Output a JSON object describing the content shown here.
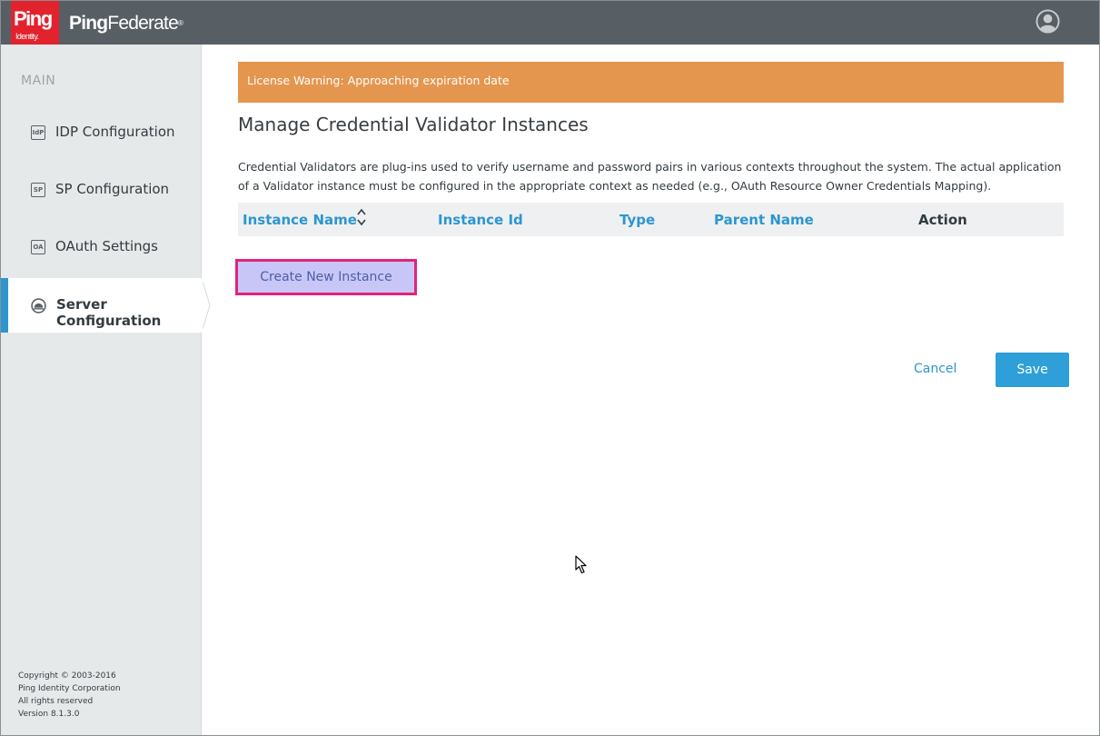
{
  "header": {
    "logo_text": "Ping",
    "logo_subtext": "Identity.",
    "product_part1": "Ping",
    "product_part2": "Federate",
    "trademark": "®"
  },
  "sidebar": {
    "section_label": "MAIN",
    "items": [
      {
        "label": "IDP Configuration",
        "icon": "IdP",
        "icon_name": "idp-icon"
      },
      {
        "label": "SP Configuration",
        "icon": "SP",
        "icon_name": "sp-icon"
      },
      {
        "label": "OAuth Settings",
        "icon": "OA",
        "icon_name": "oauth-icon"
      },
      {
        "label": "Server Configuration",
        "icon": "",
        "icon_name": "server-icon",
        "active": true
      }
    ],
    "copyright": [
      "Copyright © 2003-2016",
      "Ping Identity Corporation",
      "All rights reserved",
      "Version 8.1.3.0"
    ]
  },
  "main": {
    "banner": "License Warning: Approaching expiration date",
    "title": "Manage Credential Validator Instances",
    "description": "Credential Validators are plug-ins used to verify username and password pairs in various contexts throughout the system. The actual application of a Validator instance must be configured in the appropriate context as needed (e.g., OAuth Resource Owner Credentials Mapping).",
    "table": {
      "columns": [
        "Instance Name",
        "Instance Id",
        "Type",
        "Parent Name",
        "Action"
      ]
    },
    "create_button": "Create New Instance",
    "cancel_button": "Cancel",
    "save_button": "Save"
  },
  "colors": {
    "header_bg": "#575f65",
    "logo_red": "#e2232e",
    "accent_blue": "#2d96cf",
    "banner_orange": "#e4964f",
    "highlight_pink": "#e2237a"
  }
}
